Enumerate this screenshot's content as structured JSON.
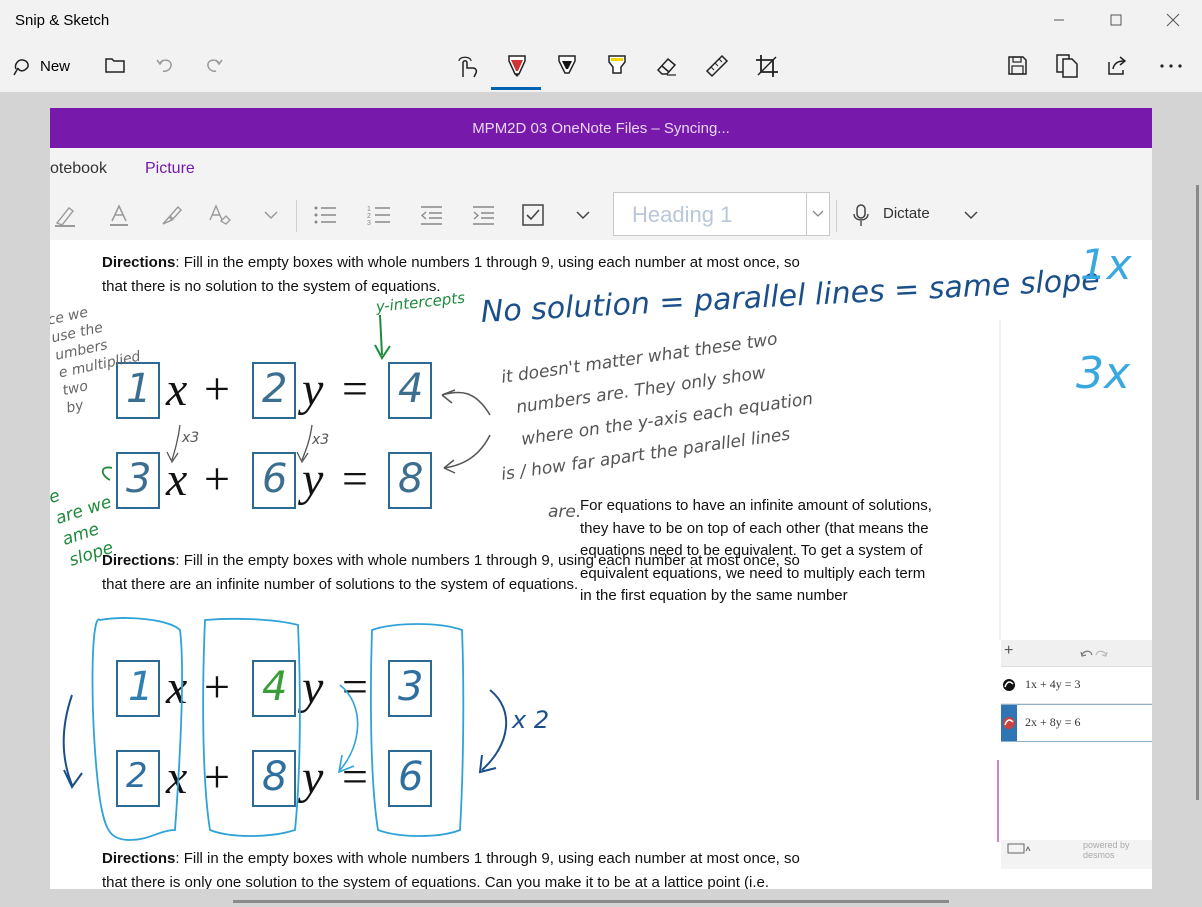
{
  "app": {
    "title": "Snip & Sketch"
  },
  "toolbar": {
    "new_label": "New",
    "icons": [
      "new-snip-icon",
      "open-folder-icon",
      "undo-icon",
      "redo-icon",
      "touch-writing-icon",
      "ballpoint-pen-icon",
      "pencil-icon",
      "highlighter-icon",
      "eraser-icon",
      "ruler-icon",
      "crop-icon",
      "save-icon",
      "copy-icon",
      "share-icon",
      "more-options-icon"
    ],
    "active_tool": "ballpoint-pen-icon",
    "colors": {
      "accent": "#0063b1",
      "pen": "#d13438",
      "pencil": "#111111",
      "highlighter": "#f3d600"
    }
  },
  "onenote": {
    "title_bar": "MPM2D 03 OneNote Files – Syncing...",
    "title_bar_color": "#7719aa",
    "tabs": [
      {
        "label": "otebook"
      },
      {
        "label": "Picture"
      }
    ],
    "style_box": "Heading 1",
    "dictate_label": "Dictate"
  },
  "content": {
    "directions_label": "Directions",
    "dir1_line1": ": Fill in the empty boxes with whole numbers 1 through 9, using each number at most once, so",
    "dir1_line2": "that there is no solution to the system of equations.",
    "dir2_line1": ": Fill in the empty boxes with whole numbers 1 through 9, using each number at most once, so",
    "dir2_line2": "that there are an infinite number of solutions to the system of equations.",
    "dir3_line1": ": Fill in the empty boxes with whole numbers 1 through 9, using each number at most once, so",
    "dir3_line2": "that there is only one solution to the system of equations.  Can you make it to be at a lattice point (i.e.",
    "explain_lines": [
      "For equations to have an infinite amount of solutions,",
      "they have to be on top of each other (that means the",
      "equations need to be equivalent. To get a system of",
      "equivalent equations, we need to multiply each term",
      "in the first equation by the same number"
    ],
    "math": {
      "x": "x",
      "y": "y",
      "plus": "+",
      "equals": "="
    },
    "system1": {
      "eq1": [
        "1",
        "2",
        "4"
      ],
      "eq2": [
        "3",
        "6",
        "8"
      ]
    },
    "system2": {
      "eq1": [
        "1",
        "4",
        "3"
      ],
      "eq2": [
        "2",
        "8",
        "6"
      ]
    }
  },
  "handwriting": {
    "no_solution": "No solution = parallel lines = same slope",
    "y_intercepts": "y-intercepts",
    "note1": "it doesn't matter what these two",
    "note2": "numbers are. They only show",
    "note3": "where on the y-axis each equation",
    "note4": "is / how far apart the parallel lines",
    "note5": "are.",
    "times3_a": "x3",
    "times3_b": "x3",
    "times2": "x 2",
    "left_note": [
      "ce we",
      "use the",
      "umbers",
      "e multiplied",
      "two",
      "by"
    ],
    "green_left": [
      "e",
      "are we",
      "ame",
      "slope"
    ],
    "right_1x": "1x",
    "right_3x": "3x"
  },
  "desmos": {
    "expr1": "1x + 4y = 3",
    "expr2": "2x + 8y = 6",
    "watermark": "powered by desmos"
  }
}
